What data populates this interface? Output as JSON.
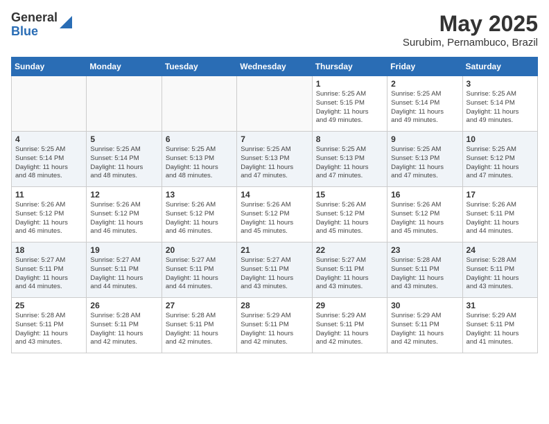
{
  "header": {
    "logo_general": "General",
    "logo_blue": "Blue",
    "month_year": "May 2025",
    "location": "Surubim, Pernambuco, Brazil"
  },
  "weekdays": [
    "Sunday",
    "Monday",
    "Tuesday",
    "Wednesday",
    "Thursday",
    "Friday",
    "Saturday"
  ],
  "weeks": [
    [
      {
        "day": "",
        "info": ""
      },
      {
        "day": "",
        "info": ""
      },
      {
        "day": "",
        "info": ""
      },
      {
        "day": "",
        "info": ""
      },
      {
        "day": "1",
        "info": "Sunrise: 5:25 AM\nSunset: 5:15 PM\nDaylight: 11 hours\nand 49 minutes."
      },
      {
        "day": "2",
        "info": "Sunrise: 5:25 AM\nSunset: 5:14 PM\nDaylight: 11 hours\nand 49 minutes."
      },
      {
        "day": "3",
        "info": "Sunrise: 5:25 AM\nSunset: 5:14 PM\nDaylight: 11 hours\nand 49 minutes."
      }
    ],
    [
      {
        "day": "4",
        "info": "Sunrise: 5:25 AM\nSunset: 5:14 PM\nDaylight: 11 hours\nand 48 minutes."
      },
      {
        "day": "5",
        "info": "Sunrise: 5:25 AM\nSunset: 5:14 PM\nDaylight: 11 hours\nand 48 minutes."
      },
      {
        "day": "6",
        "info": "Sunrise: 5:25 AM\nSunset: 5:13 PM\nDaylight: 11 hours\nand 48 minutes."
      },
      {
        "day": "7",
        "info": "Sunrise: 5:25 AM\nSunset: 5:13 PM\nDaylight: 11 hours\nand 47 minutes."
      },
      {
        "day": "8",
        "info": "Sunrise: 5:25 AM\nSunset: 5:13 PM\nDaylight: 11 hours\nand 47 minutes."
      },
      {
        "day": "9",
        "info": "Sunrise: 5:25 AM\nSunset: 5:13 PM\nDaylight: 11 hours\nand 47 minutes."
      },
      {
        "day": "10",
        "info": "Sunrise: 5:25 AM\nSunset: 5:12 PM\nDaylight: 11 hours\nand 47 minutes."
      }
    ],
    [
      {
        "day": "11",
        "info": "Sunrise: 5:26 AM\nSunset: 5:12 PM\nDaylight: 11 hours\nand 46 minutes."
      },
      {
        "day": "12",
        "info": "Sunrise: 5:26 AM\nSunset: 5:12 PM\nDaylight: 11 hours\nand 46 minutes."
      },
      {
        "day": "13",
        "info": "Sunrise: 5:26 AM\nSunset: 5:12 PM\nDaylight: 11 hours\nand 46 minutes."
      },
      {
        "day": "14",
        "info": "Sunrise: 5:26 AM\nSunset: 5:12 PM\nDaylight: 11 hours\nand 45 minutes."
      },
      {
        "day": "15",
        "info": "Sunrise: 5:26 AM\nSunset: 5:12 PM\nDaylight: 11 hours\nand 45 minutes."
      },
      {
        "day": "16",
        "info": "Sunrise: 5:26 AM\nSunset: 5:12 PM\nDaylight: 11 hours\nand 45 minutes."
      },
      {
        "day": "17",
        "info": "Sunrise: 5:26 AM\nSunset: 5:11 PM\nDaylight: 11 hours\nand 44 minutes."
      }
    ],
    [
      {
        "day": "18",
        "info": "Sunrise: 5:27 AM\nSunset: 5:11 PM\nDaylight: 11 hours\nand 44 minutes."
      },
      {
        "day": "19",
        "info": "Sunrise: 5:27 AM\nSunset: 5:11 PM\nDaylight: 11 hours\nand 44 minutes."
      },
      {
        "day": "20",
        "info": "Sunrise: 5:27 AM\nSunset: 5:11 PM\nDaylight: 11 hours\nand 44 minutes."
      },
      {
        "day": "21",
        "info": "Sunrise: 5:27 AM\nSunset: 5:11 PM\nDaylight: 11 hours\nand 43 minutes."
      },
      {
        "day": "22",
        "info": "Sunrise: 5:27 AM\nSunset: 5:11 PM\nDaylight: 11 hours\nand 43 minutes."
      },
      {
        "day": "23",
        "info": "Sunrise: 5:28 AM\nSunset: 5:11 PM\nDaylight: 11 hours\nand 43 minutes."
      },
      {
        "day": "24",
        "info": "Sunrise: 5:28 AM\nSunset: 5:11 PM\nDaylight: 11 hours\nand 43 minutes."
      }
    ],
    [
      {
        "day": "25",
        "info": "Sunrise: 5:28 AM\nSunset: 5:11 PM\nDaylight: 11 hours\nand 43 minutes."
      },
      {
        "day": "26",
        "info": "Sunrise: 5:28 AM\nSunset: 5:11 PM\nDaylight: 11 hours\nand 42 minutes."
      },
      {
        "day": "27",
        "info": "Sunrise: 5:28 AM\nSunset: 5:11 PM\nDaylight: 11 hours\nand 42 minutes."
      },
      {
        "day": "28",
        "info": "Sunrise: 5:29 AM\nSunset: 5:11 PM\nDaylight: 11 hours\nand 42 minutes."
      },
      {
        "day": "29",
        "info": "Sunrise: 5:29 AM\nSunset: 5:11 PM\nDaylight: 11 hours\nand 42 minutes."
      },
      {
        "day": "30",
        "info": "Sunrise: 5:29 AM\nSunset: 5:11 PM\nDaylight: 11 hours\nand 42 minutes."
      },
      {
        "day": "31",
        "info": "Sunrise: 5:29 AM\nSunset: 5:11 PM\nDaylight: 11 hours\nand 41 minutes."
      }
    ]
  ]
}
